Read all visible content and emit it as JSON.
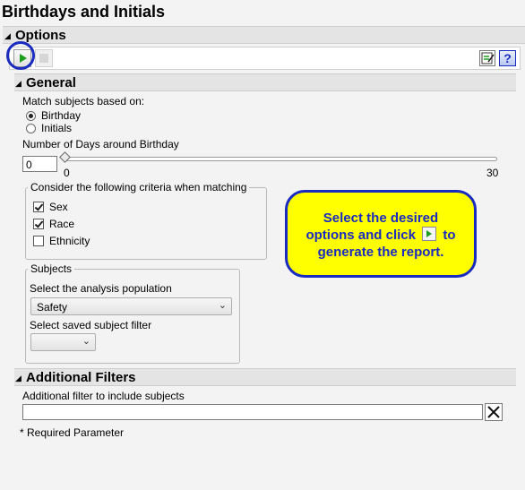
{
  "window": {
    "title": "Birthdays and Initials"
  },
  "options": {
    "header": "Options"
  },
  "toolbar": {
    "run_icon": "play-icon",
    "stop_icon": "stop-icon",
    "save_icon": "save-settings-icon",
    "help_icon": "help-icon",
    "help_label": "?"
  },
  "general": {
    "header": "General",
    "match_label": "Match subjects based on:",
    "match_options": [
      "Birthday",
      "Initials"
    ],
    "match_selected": "Birthday",
    "days_label": "Number of Days around Birthday",
    "days_value": "0",
    "slider_min": "0",
    "slider_max": "30",
    "slider_value": 0
  },
  "criteria": {
    "legend": "Consider the following criteria when matching",
    "items": [
      {
        "label": "Sex",
        "checked": true
      },
      {
        "label": "Race",
        "checked": true
      },
      {
        "label": "Ethnicity",
        "checked": false
      }
    ]
  },
  "subjects": {
    "legend": "Subjects",
    "population_label": "Select the analysis population",
    "population_value": "Safety",
    "filter_label": "Select saved subject filter",
    "filter_value": ""
  },
  "additional": {
    "header": "Additional Filters",
    "filter_label": "Additional filter to include subjects",
    "filter_value": "",
    "clear_icon": "close-icon"
  },
  "footer": {
    "required": "* Required Parameter"
  },
  "callout": {
    "line1": "Select the desired",
    "line2_pre": "options and click",
    "line2_post": "to",
    "line3": "generate the report."
  },
  "colors": {
    "accent_blue": "#1a2bbf",
    "callout_bg": "#ffff00",
    "run_green": "#1e9e1e"
  }
}
